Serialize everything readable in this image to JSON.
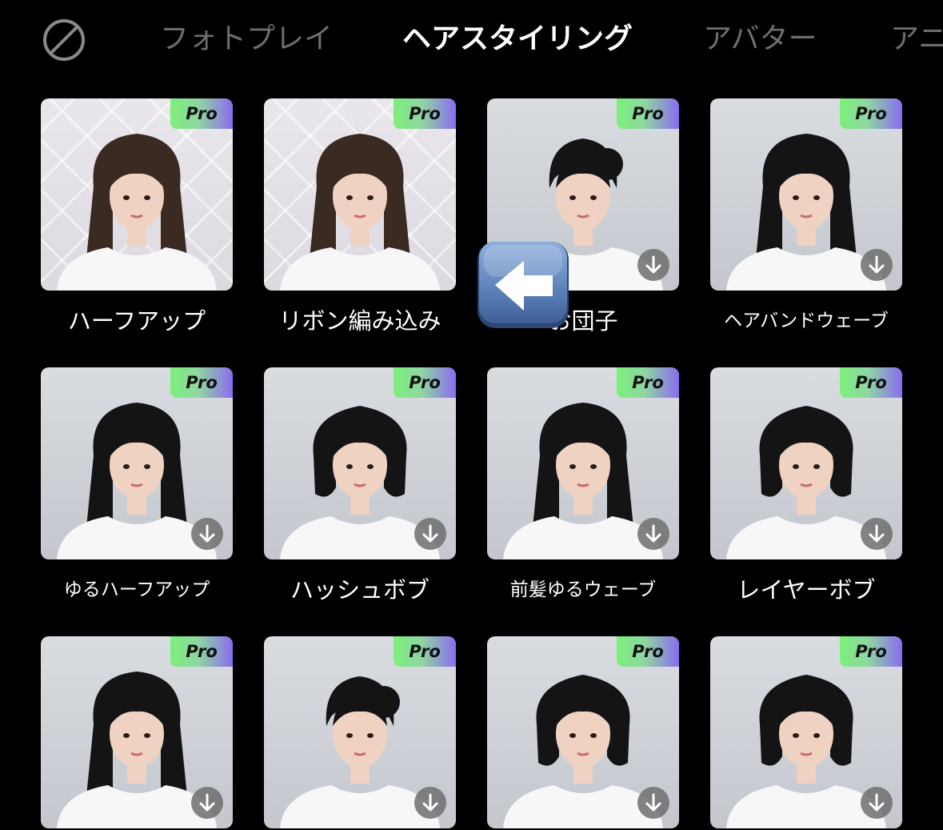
{
  "tabs": [
    {
      "label": "フォトプレイ",
      "active": false
    },
    {
      "label": "ヘアスタイリング",
      "active": true
    },
    {
      "label": "アバター",
      "active": false
    },
    {
      "label": "アニ",
      "active": false
    }
  ],
  "none_icon": "prohibited-circle-icon",
  "pro_label": "Pro",
  "download_icon": "download-arrow-icon",
  "overlay_icon": "left-arrow-emoji-icon",
  "styles": [
    {
      "label": "ハーフアップ"
    },
    {
      "label": "リボン編み込み"
    },
    {
      "label": "お団子"
    },
    {
      "label": "ヘアバンドウェーブ"
    },
    {
      "label": "ゆるハーフアップ"
    },
    {
      "label": "ハッシュボブ"
    },
    {
      "label": "前髪ゆるウェーブ"
    },
    {
      "label": "レイヤーボブ"
    },
    {
      "label": ""
    },
    {
      "label": ""
    },
    {
      "label": ""
    },
    {
      "label": ""
    }
  ],
  "colors": {
    "background": "#000000",
    "tab_inactive": "#6e6e6e",
    "tab_active": "#ffffff",
    "pro_gradient_start": "#7cf07a",
    "pro_gradient_end": "#8a6cf0",
    "overlay_blue": "#4a6ea8"
  }
}
